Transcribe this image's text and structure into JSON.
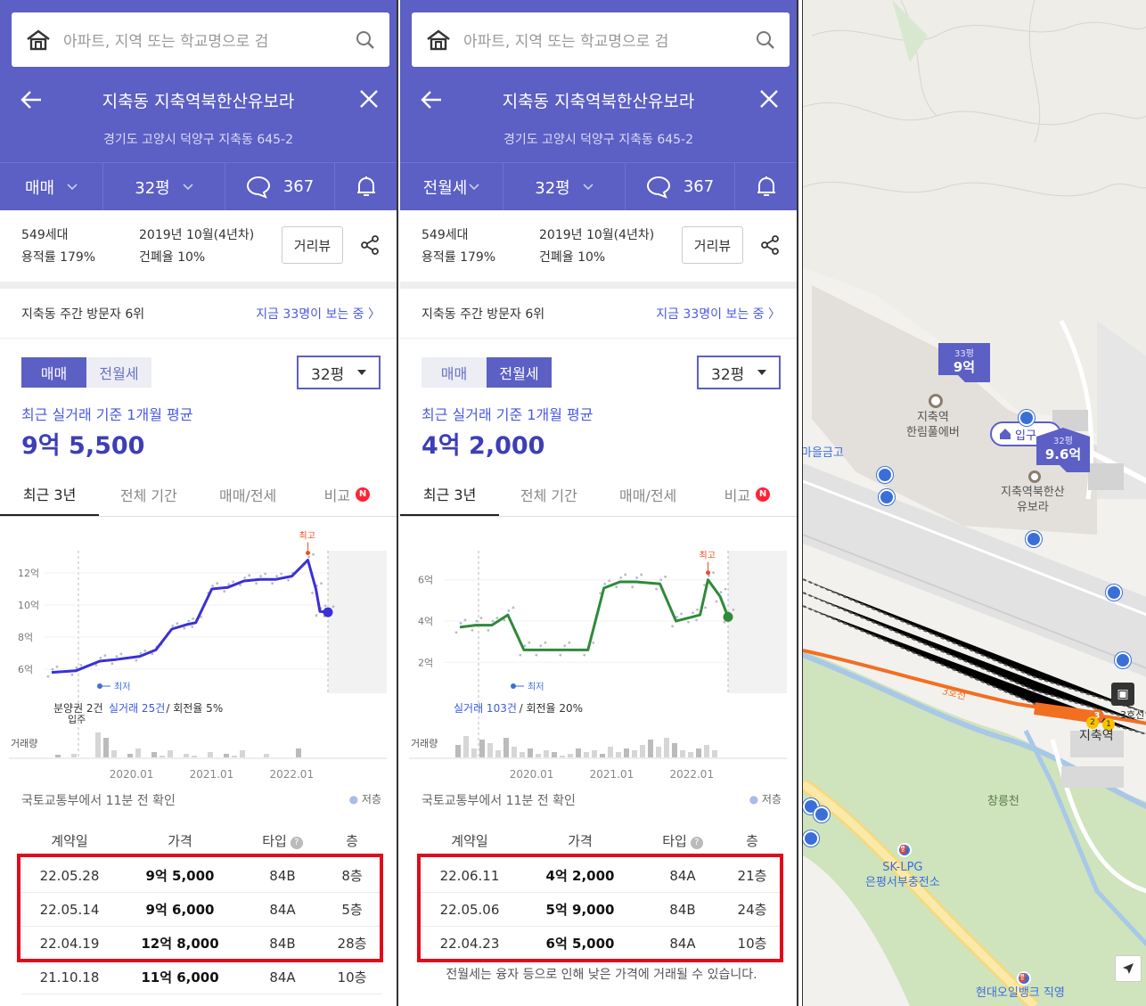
{
  "left": {
    "search_placeholder": "아파트, 지역 또는 학교명으로 검",
    "title": "지축동 지축역북한산유보라",
    "address": "경기도 고양시 덕양구 지축동 645-2",
    "deal_select": "매매",
    "size_select": "32평",
    "comment_count": "367",
    "households": "549세대",
    "floor_area_ratio": "용적률 179%",
    "built": "2019년 10월(4년차)",
    "coverage_ratio": "건폐율 10%",
    "route_button": "거리뷰",
    "visitor_rank": "지축동 주간 방문자 6위",
    "visitor_now": "지금 33명이 보는 중 〉",
    "toggle_sale": "매매",
    "toggle_rent": "전월세",
    "size_dropdown": "32평",
    "avg_label": "최근 실거래 기준 1개월 평균",
    "avg_price": "9억 5,500",
    "tabs": [
      "최근 3년",
      "전체 기간",
      "매매/전세",
      "비교"
    ],
    "tab_badge": "N",
    "chart_note_presale": "분양권 2건",
    "chart_note_trades": "실거래 25건",
    "chart_note_turnover": "/ 회전율 5%",
    "chart_note_movein": "입주",
    "chart_high_label": "최고",
    "chart_low_label": "최저",
    "chart_volume_label": "거래량",
    "source": "국토교통부에서 11분 전 확인",
    "legend_low_floor": "저층",
    "table_headers": [
      "계약일",
      "가격",
      "타입",
      "층"
    ],
    "table_help": "?",
    "rows": [
      {
        "date": "22.05.28",
        "price": "9억 5,000",
        "type": "84B",
        "floor": "8층"
      },
      {
        "date": "22.05.14",
        "price": "9억 6,000",
        "type": "84A",
        "floor": "5층"
      },
      {
        "date": "22.04.19",
        "price": "12억 8,000",
        "type": "84B",
        "floor": "28층"
      },
      {
        "date": "21.10.18",
        "price": "11억 6,000",
        "type": "84A",
        "floor": "10층"
      }
    ]
  },
  "right": {
    "search_placeholder": "아파트, 지역 또는 학교명으로 검",
    "title": "지축동 지축역북한산유보라",
    "address": "경기도 고양시 덕양구 지축동 645-2",
    "deal_select": "전월세",
    "size_select": "32평",
    "comment_count": "367",
    "households": "549세대",
    "floor_area_ratio": "용적률 179%",
    "built": "2019년 10월(4년차)",
    "coverage_ratio": "건폐율 10%",
    "route_button": "거리뷰",
    "visitor_rank": "지축동 주간 방문자 6위",
    "visitor_now": "지금 33명이 보는 중 〉",
    "toggle_sale": "매매",
    "toggle_rent": "전월세",
    "size_dropdown": "32평",
    "avg_label": "최근 실거래 기준 1개월 평균",
    "avg_price": "4억 2,000",
    "tabs": [
      "최근 3년",
      "전체 기간",
      "매매/전세",
      "비교"
    ],
    "tab_badge": "N",
    "chart_note_trades": "실거래 103건",
    "chart_note_turnover": "/ 회전율 20%",
    "chart_high_label": "최고",
    "chart_low_label": "최저",
    "chart_volume_label": "거래량",
    "source": "국토교통부에서 11분 전 확인",
    "legend_low_floor": "저층",
    "table_headers": [
      "계약일",
      "가격",
      "타입",
      "층"
    ],
    "table_help": "?",
    "rows": [
      {
        "date": "22.06.11",
        "price": "4억 2,000",
        "type": "84A",
        "floor": "21층"
      },
      {
        "date": "22.05.06",
        "price": "5억 9,000",
        "type": "84B",
        "floor": "24층"
      },
      {
        "date": "22.04.23",
        "price": "6억 5,000",
        "type": "84A",
        "floor": "10층"
      }
    ],
    "footnote": "전월세는 융자 등으로 인해 낮은 가격에 거래될 수 있습니다."
  },
  "chart_data": [
    {
      "type": "line",
      "title": "",
      "ylabel": "",
      "x_ticks": [
        "2020.01",
        "2021.01",
        "2022.01"
      ],
      "y_ticks": [
        "6억",
        "8억",
        "10억",
        "12억"
      ],
      "ylim": [
        4.5,
        13.5
      ],
      "series": [
        {
          "x": [
            2019.0,
            2019.3,
            2019.6,
            2019.8,
            2020.1,
            2020.3,
            2020.5,
            2020.7,
            2020.8,
            2021.0,
            2021.2,
            2021.4,
            2021.6,
            2021.8,
            2022.0,
            2022.2,
            2022.3,
            2022.35,
            2022.45
          ],
          "y": [
            5.8,
            5.9,
            6.5,
            6.6,
            6.8,
            7.2,
            8.5,
            8.8,
            8.9,
            11.0,
            11.1,
            11.5,
            11.6,
            11.6,
            11.8,
            12.8,
            11.0,
            9.6,
            9.55
          ]
        }
      ],
      "volume_xlabel": "거래량",
      "annotations": [
        "최고",
        "최저",
        "분양권 2건",
        "실거래 25건 / 회전율 5%",
        "입주"
      ],
      "grid": true,
      "legend": "none"
    },
    {
      "type": "line",
      "title": "",
      "ylabel": "",
      "x_ticks": [
        "2020.01",
        "2021.01",
        "2022.01"
      ],
      "y_ticks": [
        "2억",
        "4억",
        "6억"
      ],
      "ylim": [
        0.5,
        7.5
      ],
      "series": [
        {
          "x": [
            2019.1,
            2019.3,
            2019.5,
            2019.7,
            2019.9,
            2020.1,
            2020.4,
            2020.7,
            2020.9,
            2021.1,
            2021.3,
            2021.6,
            2021.8,
            2022.0,
            2022.1,
            2022.2,
            2022.35,
            2022.45
          ],
          "y": [
            3.7,
            3.8,
            3.8,
            4.3,
            2.6,
            2.6,
            2.6,
            2.6,
            5.6,
            5.9,
            5.9,
            5.8,
            4.0,
            4.2,
            4.3,
            6.0,
            5.2,
            4.2
          ]
        }
      ],
      "annotations": [
        "최고",
        "최저",
        "실거래 103건 / 회전율 20%"
      ],
      "grid": true,
      "legend": "none"
    }
  ],
  "map": {
    "marker_33_size": "33평",
    "marker_33_price": "9억",
    "label_hanrim": "지축역\n한림풀에버",
    "marker_32_size": "32평",
    "marker_32_price": "9.6억",
    "label_entrance": "입구",
    "label_yubora": "지축역북한산\n유보라",
    "label_saemaeul": "마을금고",
    "label_line3": "3호선",
    "label_line3_right": "3호선",
    "label_station": "지축역",
    "label_stream": "창릉천",
    "label_lpg": "SK-LPG\n은평서부충전소",
    "label_gas": "현대오일뱅크 직영"
  }
}
